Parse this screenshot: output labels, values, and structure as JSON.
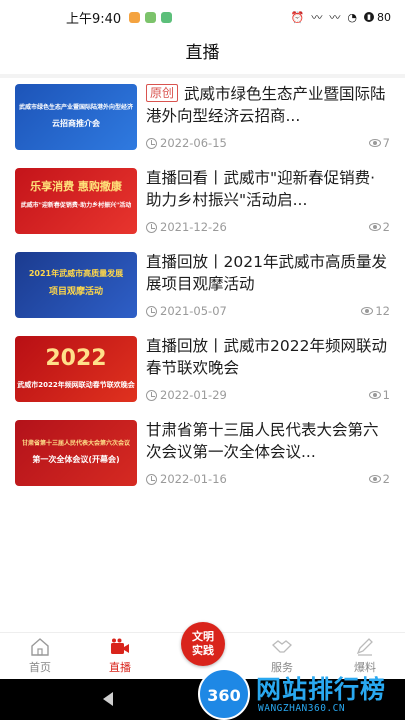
{
  "status_bar": {
    "time": "上午9:40",
    "apps": [
      "#f4a340",
      "#7cc36b",
      "#5cbf7a"
    ],
    "battery": "80"
  },
  "header": {
    "title": "直播"
  },
  "items": [
    {
      "badge": "原创",
      "title": "武威市绿色生态产业暨国际陆港外向型经济云招商...",
      "date": "2022-06-15",
      "views": "7",
      "thumb": {
        "text1": "武威市绿色生态产业暨国际陆港外向型经济",
        "text2": "云招商推介会",
        "bg": "#1d54b8",
        "bg2": "#2f7ae0",
        "color": "#ffffff"
      }
    },
    {
      "badge": "",
      "title": "直播回看丨武威市\"迎新春促销费·助力乡村振兴\"活动启...",
      "date": "2021-12-26",
      "views": "2",
      "thumb": {
        "text1": "乐享消费 惠购撒康",
        "text2": "武威市\"迎新春促销费·助力乡村振兴\"活动",
        "bg": "#c4141a",
        "bg2": "#e8352e",
        "color": "#ffe27a"
      }
    },
    {
      "badge": "",
      "title": "直播回放丨2021年武威市高质量发展项目观摩活动",
      "date": "2021-05-07",
      "views": "12",
      "thumb": {
        "text1": "2021年武威市高质量发展",
        "text2": "项目观摩活动",
        "bg": "#1b3b8f",
        "bg2": "#2e5fc7",
        "color": "#ffd84a"
      }
    },
    {
      "badge": "",
      "title": "直播回放丨武威市2022年频网联动春节联欢晚会",
      "date": "2022-01-29",
      "views": "1",
      "thumb": {
        "text1": "2022",
        "text2": "武威市2022年频网联动春节联欢晚会",
        "bg": "#b80f14",
        "bg2": "#e0321f",
        "color": "#ffe08a"
      }
    },
    {
      "badge": "",
      "title": "甘肃省第十三届人民代表大会第六次会议第一次全体会议...",
      "date": "2022-01-16",
      "views": "2",
      "thumb": {
        "text1": "甘肃省第十三届人民代表大会第六次会议",
        "text2": "第一次全体会议(开幕会)",
        "bg": "#b3121a",
        "bg2": "#d62a22",
        "color": "#ffe08a"
      }
    }
  ],
  "nav": {
    "home": "首页",
    "live": "直播",
    "center": "文明实践",
    "service": "服务",
    "report": "爆料",
    "active_color": "#d9241b"
  },
  "watermark": {
    "logo": "360",
    "text": "网站排行榜",
    "sub": "WANGZHAN360.CN"
  }
}
